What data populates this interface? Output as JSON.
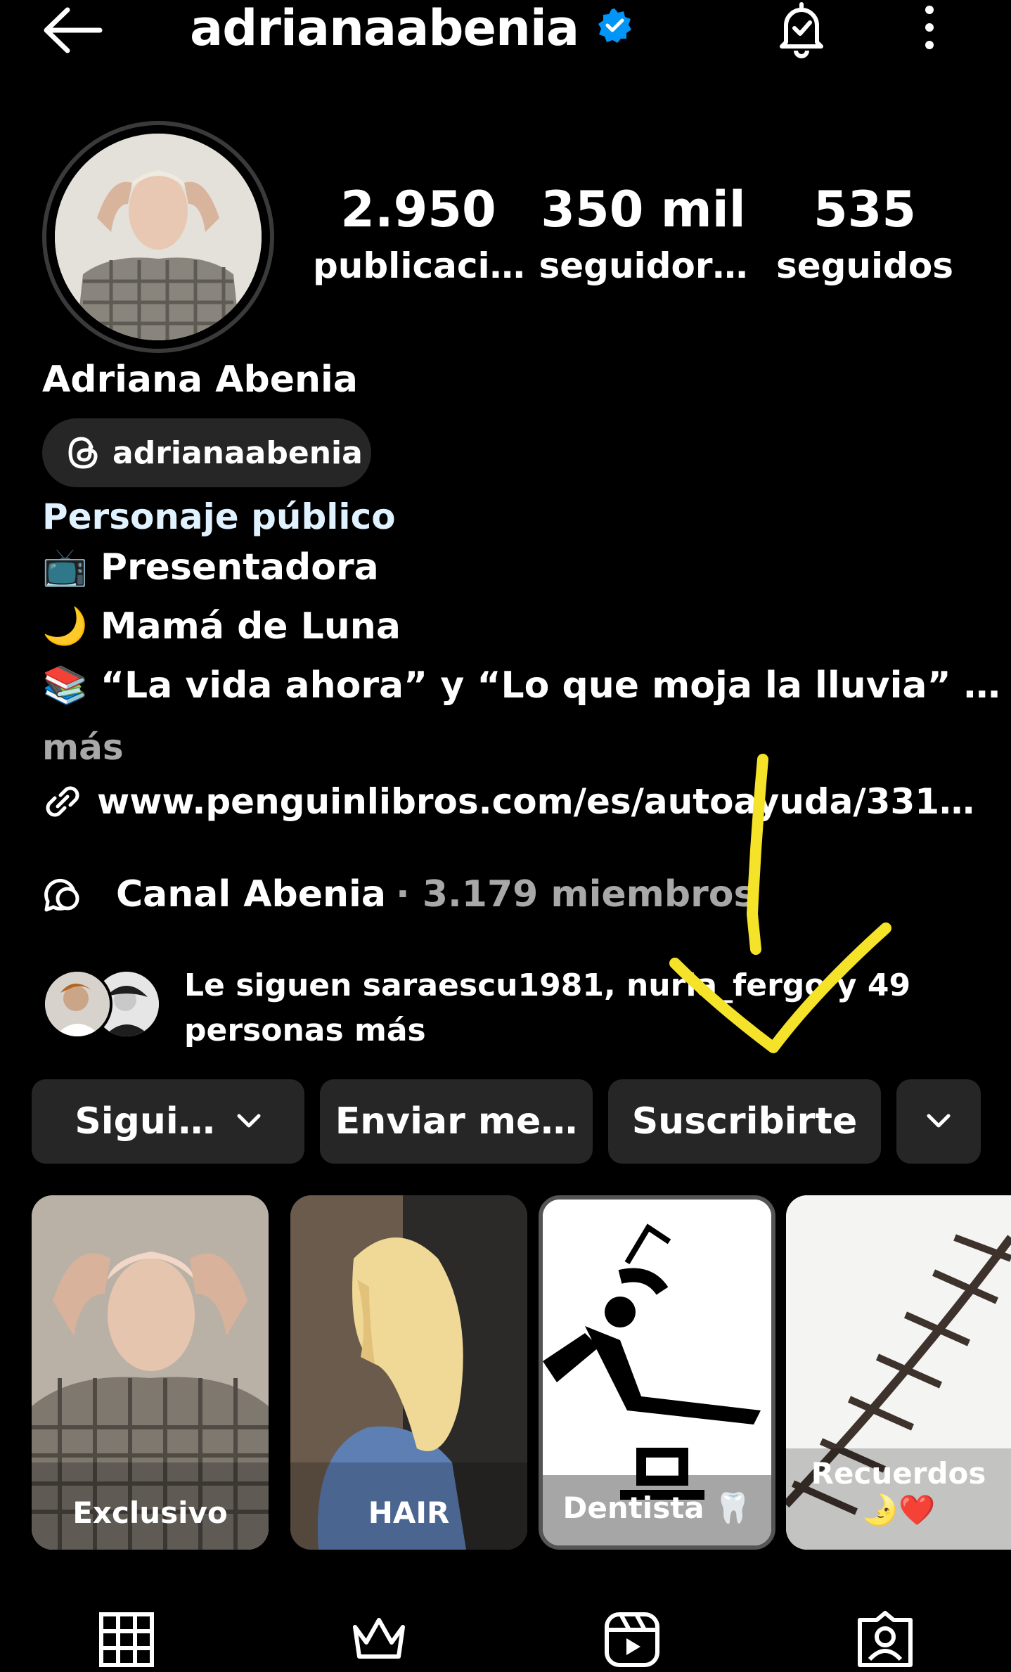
{
  "header": {
    "username": "adrianaabenia",
    "back_icon": "arrow-left-icon",
    "verified_icon": "verified-badge-icon",
    "notification_icon": "bell-check-icon",
    "more_icon": "more-vertical-icon"
  },
  "stats": {
    "posts_count": "2.950",
    "posts_label": "publicaci…",
    "followers_count": "350 mil",
    "followers_label": "seguidor…",
    "following_count": "535",
    "following_label": "seguidos"
  },
  "profile": {
    "full_name": "Adriana Abenia",
    "threads_handle": "adrianaabenia",
    "category": "Personaje público",
    "bio_lines": [
      "📺 Presentadora",
      "🌙 Mamá de Luna",
      "📚 “La vida ahora” y “Lo que moja la lluvia” …"
    ],
    "more_label": "más",
    "link": "www.penguinlibros.com/es/autoayuda/331…",
    "channel_name": "Canal Abenia",
    "channel_members": "· 3.179 miembros",
    "followed_by": "Le siguen saraescu1981, nuria_fergo y 49 personas más"
  },
  "buttons": {
    "follow": "Sigui…",
    "message": "Enviar me…",
    "subscribe": "Suscribirte"
  },
  "highlights": [
    {
      "label": "Exclusivo"
    },
    {
      "label": "HAIR"
    },
    {
      "label": "Dentista 🦷"
    },
    {
      "label": "Recuerdos",
      "emoji": "🌛❤️"
    }
  ],
  "tabs": [
    "grid-icon",
    "crown-icon",
    "reels-icon",
    "tagged-icon"
  ],
  "colors": {
    "background": "#000000",
    "button_bg": "#262626",
    "verified": "#0095f6",
    "category": "#e0f1ff",
    "muted": "#a8a8a8",
    "annotation": "#f5e32a"
  }
}
